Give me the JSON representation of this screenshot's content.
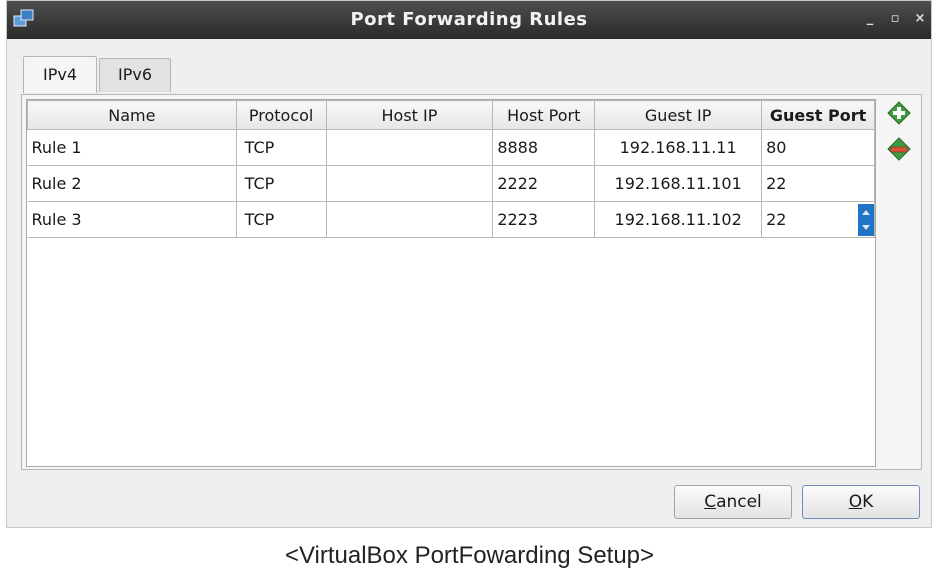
{
  "window": {
    "title": "Port Forwarding Rules",
    "minimize_glyph": "_",
    "maximize_glyph": "▫",
    "close_glyph": "×"
  },
  "tabs": [
    {
      "label": "IPv4",
      "active": true
    },
    {
      "label": "IPv6",
      "active": false
    }
  ],
  "table": {
    "columns": [
      "Name",
      "Protocol",
      "Host IP",
      "Host Port",
      "Guest IP",
      "Guest Port"
    ],
    "rows": [
      {
        "name": "Rule 1",
        "protocol": "TCP",
        "host_ip": "",
        "host_port": "8888",
        "guest_ip": "192.168.11.11",
        "guest_port": "80"
      },
      {
        "name": "Rule 2",
        "protocol": "TCP",
        "host_ip": "",
        "host_port": "2222",
        "guest_ip": "192.168.11.101",
        "guest_port": "22"
      },
      {
        "name": "Rule 3",
        "protocol": "TCP",
        "host_ip": "",
        "host_port": "2223",
        "guest_ip": "192.168.11.102",
        "guest_port": "22"
      }
    ]
  },
  "side_buttons": {
    "add_icon": "add-rule-icon",
    "remove_icon": "remove-rule-icon"
  },
  "buttons": {
    "cancel_mnemonic": "C",
    "cancel_rest": "ancel",
    "ok_mnemonic": "O",
    "ok_rest": "K"
  },
  "caption": "<VirtualBox PortFowarding Setup>",
  "colors": {
    "titlebar": "#3a3a3a",
    "spin_accent": "#1f74c8",
    "add_icon": "#3f9b3f",
    "remove_icon": "#d8523a"
  }
}
